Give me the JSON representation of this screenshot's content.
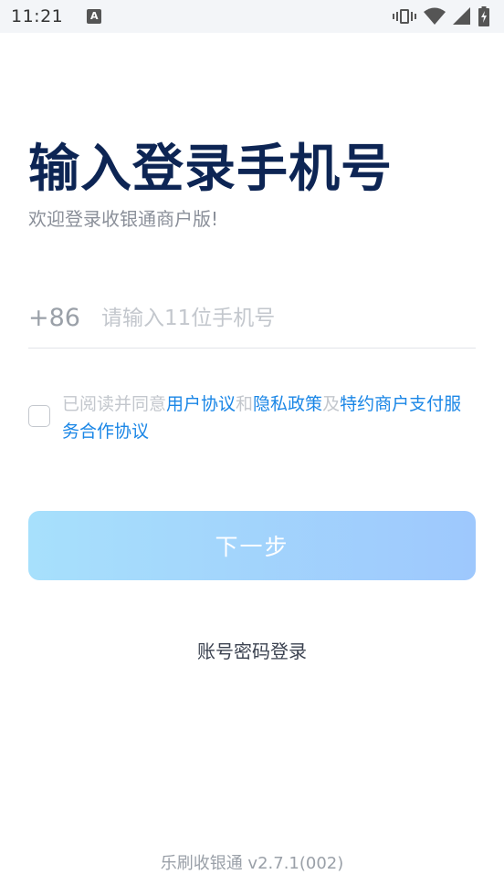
{
  "status_bar": {
    "time": "11:21",
    "notification_glyph": "A",
    "icons": [
      "vibrate-icon",
      "wifi-icon",
      "signal-icon",
      "battery-charging-icon"
    ]
  },
  "header": {
    "title": "输入登录手机号",
    "subtitle": "欢迎登录收银通商户版!"
  },
  "phone": {
    "country_code": "+86",
    "placeholder": "请输入11位手机号",
    "value": ""
  },
  "agreement": {
    "checked": false,
    "prefix": "已阅读并同意",
    "link_user": "用户协议",
    "and": "和",
    "link_privacy": "隐私政策",
    "also": "及",
    "link_service": "特约商户支付服务合作协议"
  },
  "actions": {
    "next_label": "下一步",
    "password_login_label": "账号密码登录"
  },
  "footer": {
    "version": "乐刷收银通 v2.7.1(002)"
  },
  "colors": {
    "title": "#0d2554",
    "link": "#1a86e6",
    "button_start": "#a7e0fc",
    "button_end": "#9ec8fd"
  }
}
